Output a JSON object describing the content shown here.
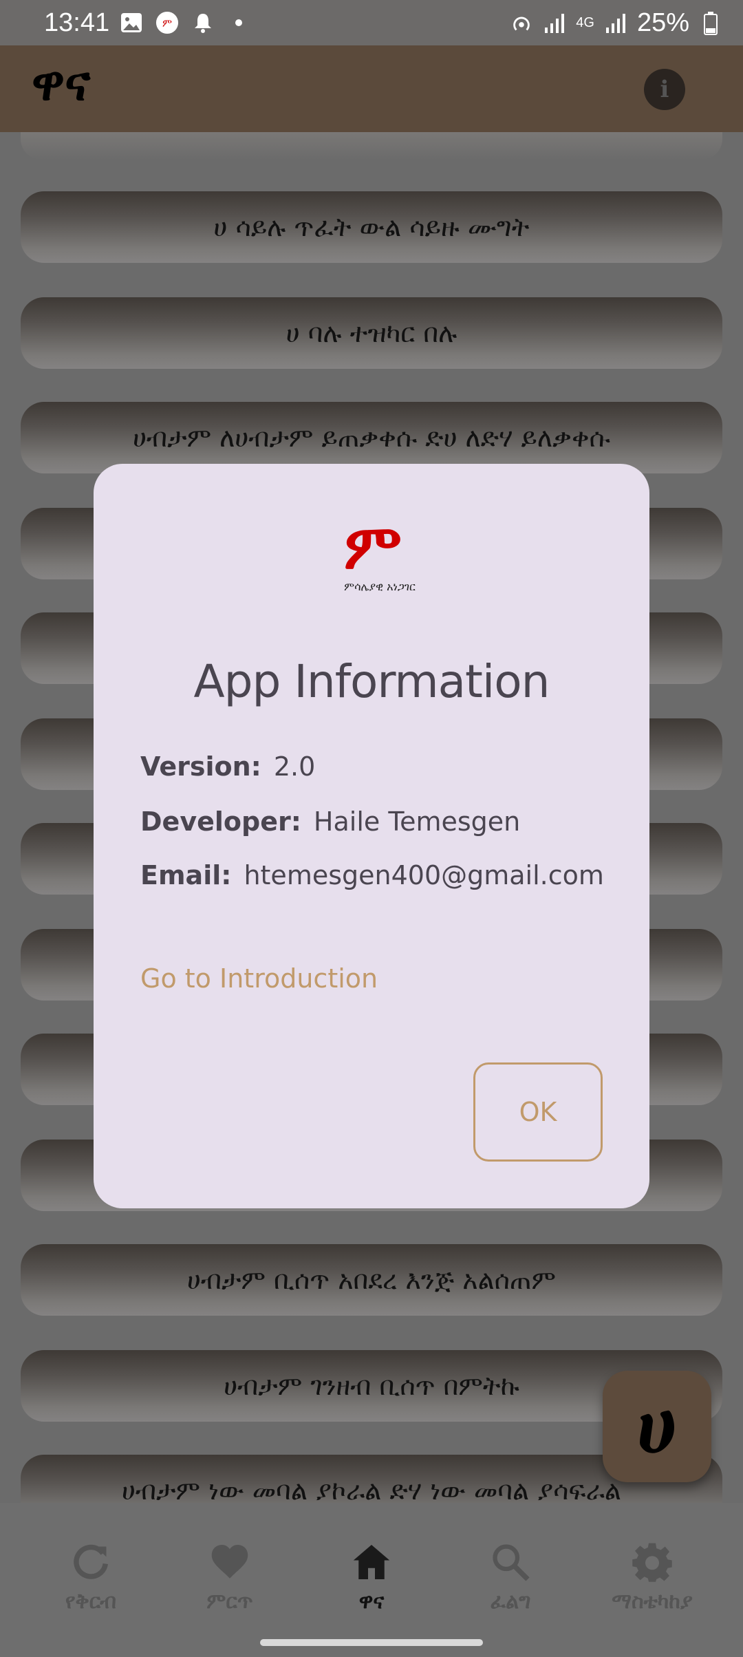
{
  "status_bar": {
    "time": "13:41",
    "battery": "25%",
    "network": "4G"
  },
  "app_bar": {
    "title": "ዋና",
    "info_icon": "info-icon"
  },
  "list": {
    "items": [
      "ሀ ሳይሉ ጥፈት ውል ሳይዙ ሙግት",
      "ሀ ባሉ ተዝካር በሉ",
      "ሀብታም ለሀብታም ይጠቃቀሱ ድሀ ለድሃ ይለቃቀሱ",
      "ሀብታም ቢሰጥ አበደረ እንጅ አልሰጠም",
      "ሀብታም ገንዘብ ቢሰጥ በምትኩ",
      "ሀብታም ነው መባል ያኮራል ድሃ ነው መባል ያሳፍራል"
    ]
  },
  "fab": {
    "label": "ሀ"
  },
  "dialog": {
    "logo_text": "ምሳሌያዊ አነጋገር",
    "title": "App Information",
    "version_label": "Version:",
    "version_value": "2.0",
    "developer_label": "Developer:",
    "developer_value": "Haile Temesgen",
    "email_label": "Email:",
    "email_value": "htemesgen400@gmail.com",
    "intro_link": "Go to Introduction",
    "ok_label": "OK",
    "accent_color": "#c19a6b"
  },
  "bottom_nav": {
    "items": [
      {
        "label": "የቅርብ",
        "icon": "refresh-icon"
      },
      {
        "label": "ምርጥ",
        "icon": "heart-icon"
      },
      {
        "label": "ዋና",
        "icon": "home-icon",
        "active": true
      },
      {
        "label": "ፈልግ",
        "icon": "search-icon"
      },
      {
        "label": "ማስቴካከያ",
        "icon": "gear-icon"
      }
    ]
  }
}
